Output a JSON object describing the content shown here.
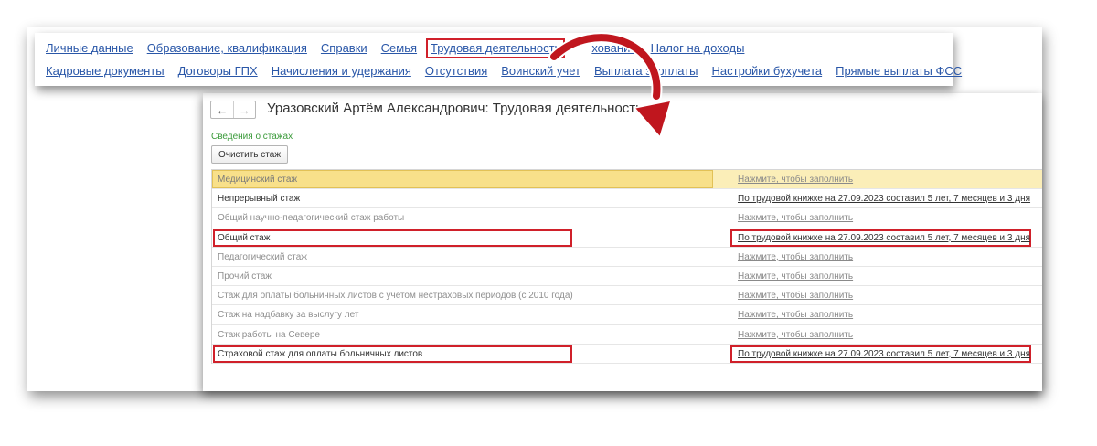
{
  "nav": {
    "row1": [
      "Личные данные",
      "Образование, квалификация",
      "Справки",
      "Семья",
      "Трудовая деятельность",
      "хование",
      "Налог на доходы"
    ],
    "row2": [
      "Кадровые документы",
      "Договоры ГПХ",
      "Начисления и удержания",
      "Отсутствия",
      "Воинский учет",
      "Выплата зарплаты",
      "Настройки бухучета",
      "Прямые выплаты ФСС"
    ]
  },
  "window": {
    "title": "Уразовский Артём Александрович: Трудовая деятельность",
    "back_icon": "←",
    "forward_icon": "→"
  },
  "section_label": "Сведения о стажах",
  "clear_button": "Очистить стаж",
  "rows": [
    {
      "name": "Медицинский стаж",
      "value": "Нажмите, чтобы заполнить"
    },
    {
      "name": "Непрерывный стаж",
      "value": "По трудовой книжке на 27.09.2023 составил 5 лет, 7 месяцев и 3 дня"
    },
    {
      "name": "Общий научно-педагогический стаж работы",
      "value": "Нажмите, чтобы заполнить"
    },
    {
      "name": "Общий стаж",
      "value": "По трудовой книжке на 27.09.2023 составил 5 лет, 7 месяцев и 3 дня"
    },
    {
      "name": "Педагогический стаж",
      "value": "Нажмите, чтобы заполнить"
    },
    {
      "name": "Прочий стаж",
      "value": "Нажмите, чтобы заполнить"
    },
    {
      "name": "Стаж для оплаты больничных листов с учетом нестраховых периодов (с 2010 года)",
      "value": "Нажмите, чтобы заполнить"
    },
    {
      "name": "Стаж на надбавку за выслугу лет",
      "value": "Нажмите, чтобы заполнить"
    },
    {
      "name": "Стаж работы на Севере",
      "value": "Нажмите, чтобы заполнить"
    },
    {
      "name": "Страховой стаж для оплаты больничных листов",
      "value": "По трудовой книжке на 27.09.2023 составил 5 лет, 7 месяцев и 3 дня"
    }
  ],
  "colors": {
    "link": "#2a57a8",
    "highlight": "#d0202a",
    "selected_row": "#f8e08a",
    "section_label": "#3a9a3a"
  }
}
